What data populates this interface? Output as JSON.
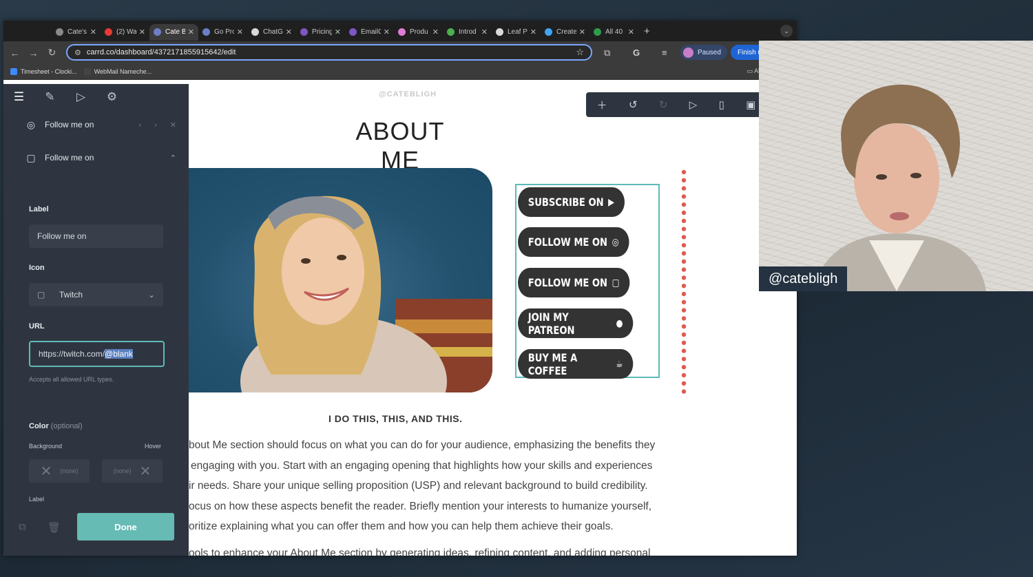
{
  "tabs": [
    {
      "label": "Cate's",
      "color": "#8a8a8a"
    },
    {
      "label": "(2) Wa",
      "color": "#e53935"
    },
    {
      "label": "Cate B",
      "color": "#6d7ec7",
      "active": true
    },
    {
      "label": "Go Pro",
      "color": "#6d7ec7"
    },
    {
      "label": "ChatG",
      "color": "#d9d9d9"
    },
    {
      "label": "Pricing",
      "color": "#7e57c2"
    },
    {
      "label": "EmailC",
      "color": "#7e57c2"
    },
    {
      "label": "Produ",
      "color": "#e07bd4"
    },
    {
      "label": "Introd",
      "color": "#4caf50"
    },
    {
      "label": "Leaf P",
      "color": "#d9d9d9"
    },
    {
      "label": "Create",
      "color": "#42a5f5"
    },
    {
      "label": "All 40",
      "color": "#2e9c4f"
    }
  ],
  "browser": {
    "url": "carrd.co/dashboard/4372171855915642/edit",
    "paused_label": "Paused",
    "finish_label": "Finish u",
    "new_tab": "+",
    "tab_close": "✕"
  },
  "bookmarks": [
    {
      "label": "Timesheet - Clocki...",
      "color": "#3d8bff"
    },
    {
      "label": "WebMail Nameche...",
      "color": "#444444"
    }
  ],
  "bookmarks_all": "All",
  "panel": {
    "items": [
      {
        "label": "Follow me on",
        "icon": "instagram-icon"
      },
      {
        "label": "Follow me on",
        "icon": "twitch-icon"
      }
    ],
    "label_title": "Label",
    "label_value": "Follow me on",
    "icon_title": "Icon",
    "icon_value": "Twitch",
    "url_title": "URL",
    "url_prefix": "https://twitch.com/",
    "url_selected": "@blank",
    "url_hint": "Accepts all allowed URL types.",
    "color_title": "Color",
    "color_optional": "(optional)",
    "background_label": "Background",
    "hover_label": "Hover",
    "none_label": "(none)",
    "label2_title": "Label",
    "done_label": "Done"
  },
  "preview": {
    "handle": "@CATEBLIGH",
    "title": "ABOUT ME",
    "buttons": [
      {
        "label": "SUBSCRIBE ON",
        "icon": "youtube-icon"
      },
      {
        "label": "FOLLOW ME ON",
        "icon": "instagram-icon"
      },
      {
        "label": "FOLLOW ME ON",
        "icon": "twitch-icon"
      },
      {
        "label": "JOIN MY PATREON",
        "icon": "patreon-icon"
      },
      {
        "label": "BUY ME A COFFEE",
        "icon": "coffee-icon"
      }
    ],
    "subheading": "I DO THIS, THIS, AND THIS.",
    "paragraph_lines": [
      "bout Me section should focus on what you can do for your audience, emphasizing the benefits they",
      "engaging with you. Start with an engaging opening that highlights how your skills and experiences",
      "ir needs. Share your unique selling proposition (USP) and relevant background to build credibility.",
      "ocus on how these aspects benefit the reader. Briefly mention your interests to humanize yourself,",
      "oritize explaining what you can offer them and how you can help them achieve their goals.",
      "ools to enhance your About Me section by generating ideas, refining content, and adding personal"
    ]
  },
  "webcam": {
    "tag": "@catebligh"
  },
  "colors": {
    "accent": "#66bbb5",
    "panel_bg": "#2f3540",
    "dot_red": "#e05a4f"
  }
}
